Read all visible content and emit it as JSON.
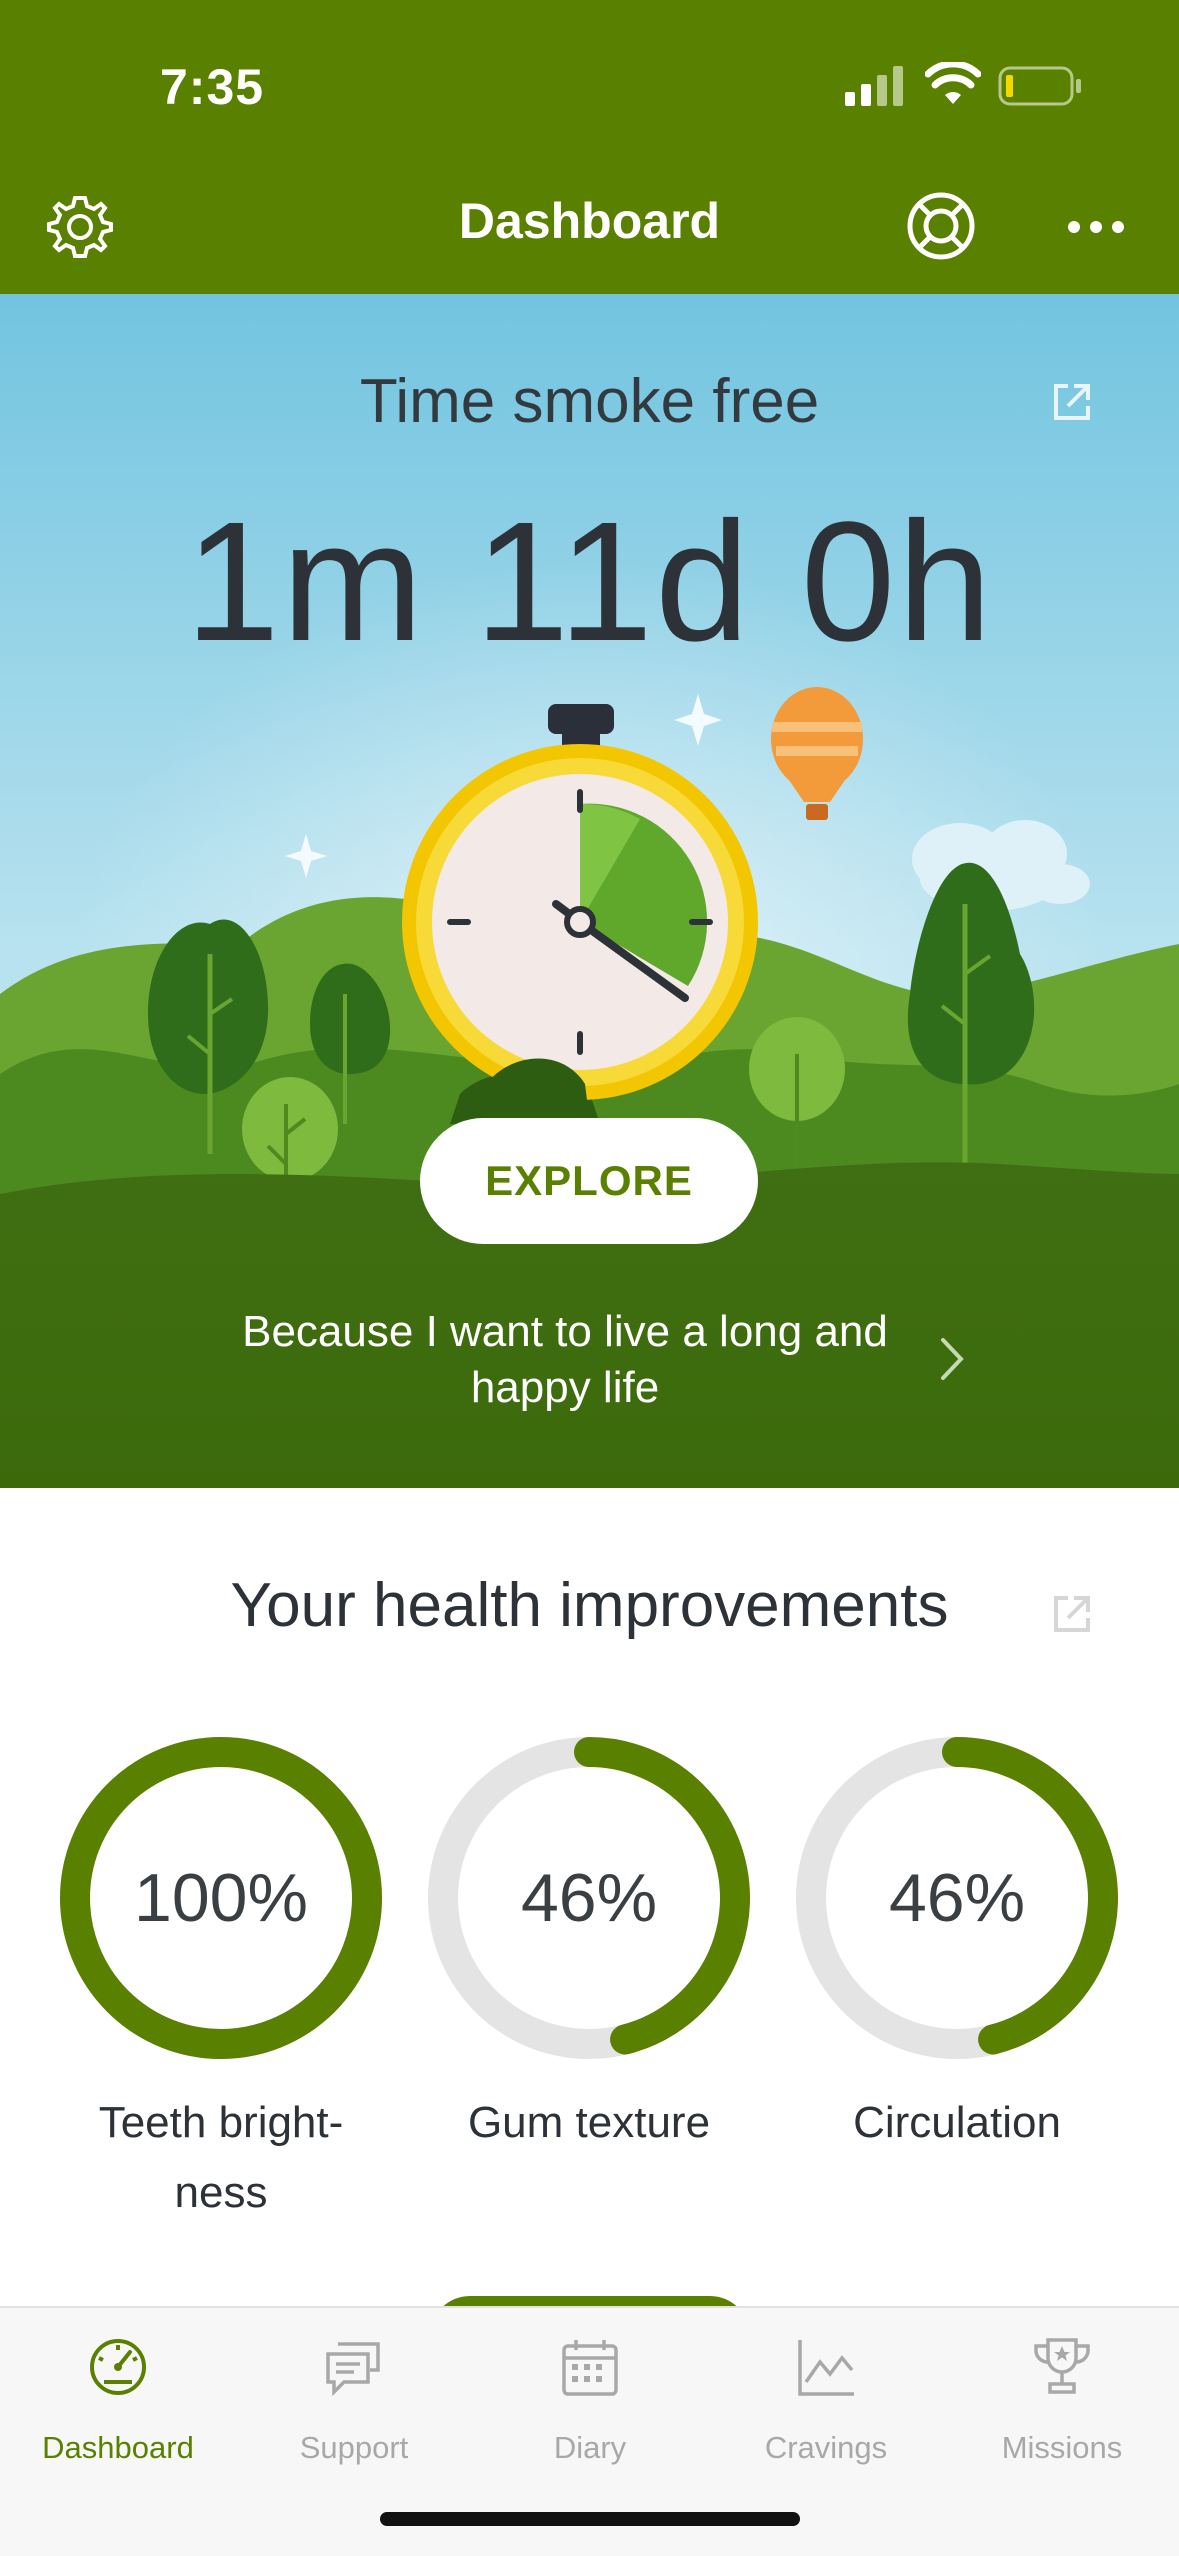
{
  "status_bar": {
    "time": "7:35"
  },
  "header": {
    "title": "Dashboard",
    "icons": [
      "gear-icon",
      "lifebuoy-icon",
      "more-icon"
    ]
  },
  "hero": {
    "title": "Time smoke free",
    "duration": "1m 11d 0h",
    "explore_label": "EXPLORE",
    "motivation": "Because I want to live a long and happy life"
  },
  "health": {
    "title": "Your health improvements",
    "items": [
      {
        "value": "100%",
        "label": "Teeth bright-\nness",
        "progress": 1.0
      },
      {
        "value": "46%",
        "label": "Gum texture",
        "progress": 0.46
      },
      {
        "value": "46%",
        "label": "Circulation",
        "progress": 0.46
      }
    ]
  },
  "tabs": [
    {
      "label": "Dashboard",
      "icon": "gauge-icon",
      "active": true
    },
    {
      "label": "Support",
      "icon": "chat-icon",
      "active": false
    },
    {
      "label": "Diary",
      "icon": "calendar-icon",
      "active": false
    },
    {
      "label": "Cravings",
      "icon": "chart-icon",
      "active": false
    },
    {
      "label": "Missions",
      "icon": "trophy-icon",
      "active": false
    }
  ],
  "colors": {
    "brand_green": "#5a8000",
    "ring_track": "#e4e4e4",
    "inactive_tab": "#a8a8a8"
  }
}
